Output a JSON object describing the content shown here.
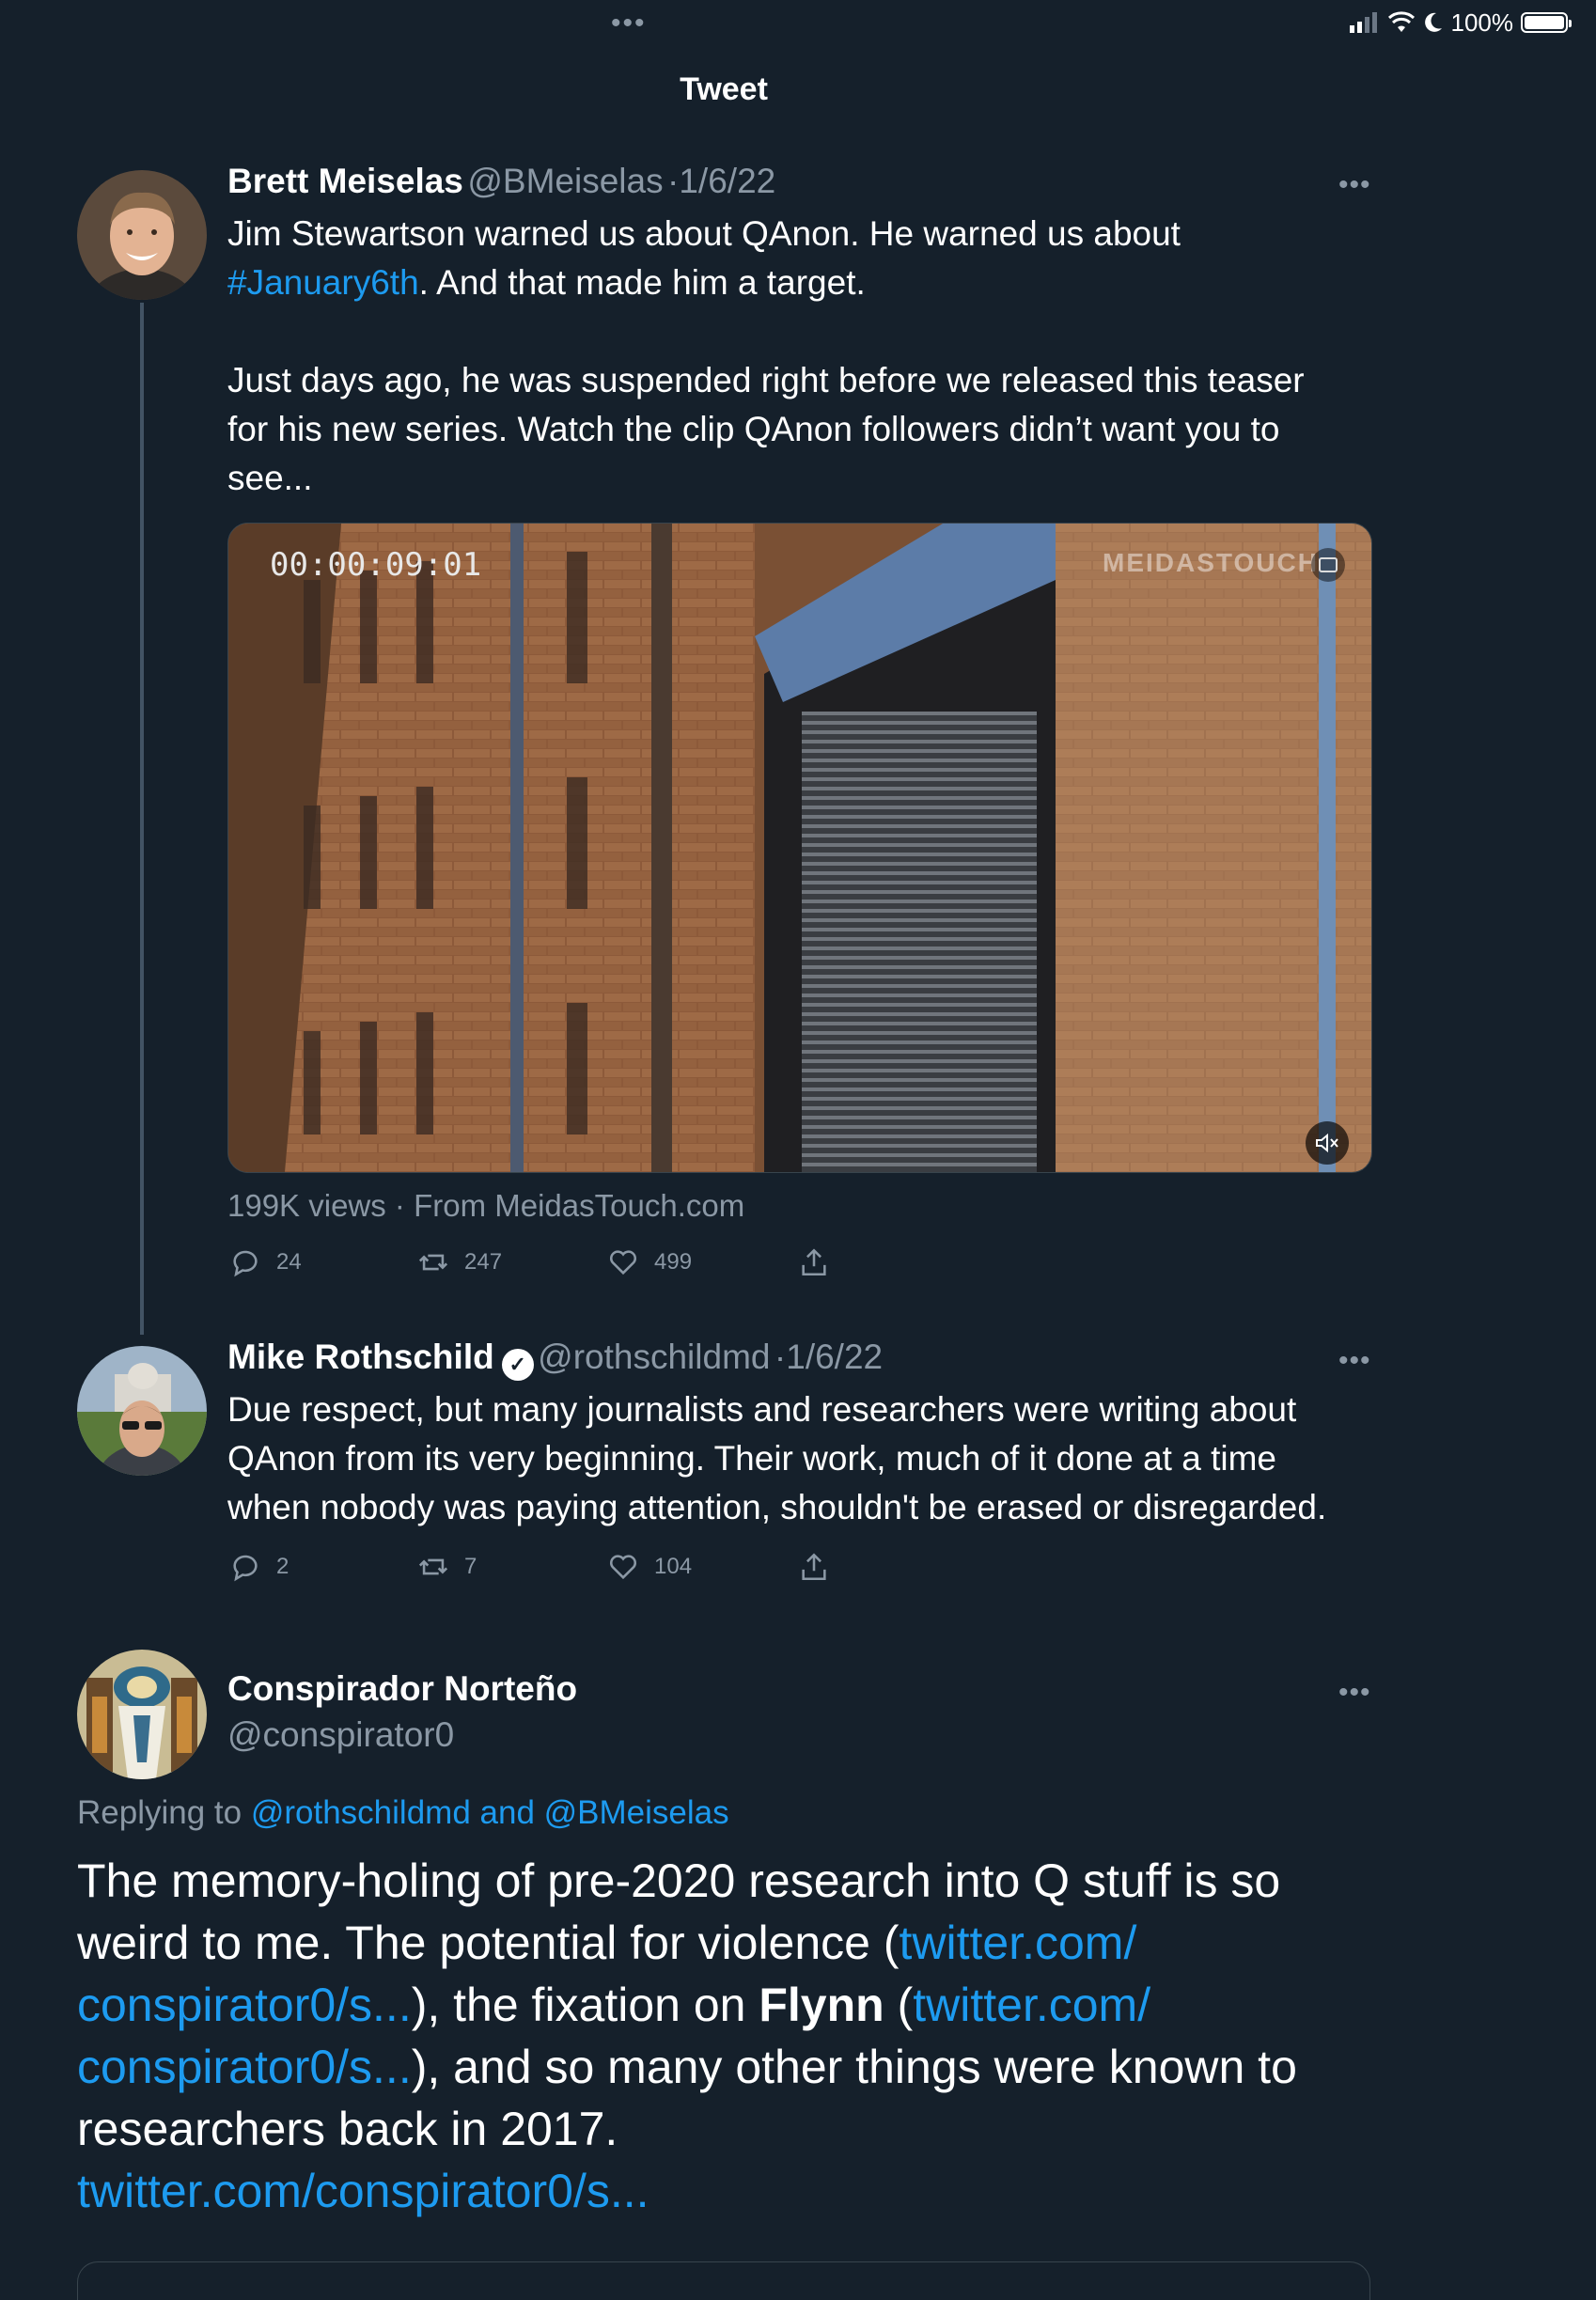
{
  "status_bar": {
    "battery": "100%"
  },
  "header": {
    "title": "Tweet"
  },
  "tweets": [
    {
      "name": "Brett Meiselas",
      "handle": "@BMeiselas",
      "date": "1/6/22",
      "text_a": "Jim Stewartson warned us about QAnon. He warned us about",
      "hashtag": "#January6th",
      "text_b": ". And that made him a target.",
      "text_c": "Just days ago, he was suspended right before we released this teaser",
      "text_d": "for his new series. Watch the clip QAnon followers didn’t want you to",
      "text_e": "see...",
      "video": {
        "timestamp": "00:00:09:01",
        "watermark": "MEIDASTOUCH"
      },
      "views": "199K views",
      "source": "From MeidasTouch.com",
      "replies": "24",
      "retweets": "247",
      "likes": "499"
    },
    {
      "name": "Mike Rothschild",
      "handle": "@rothschildmd",
      "date": "1/6/22",
      "line1": "Due respect, but many journalists and researchers were writing about",
      "line2": "QAnon from its very beginning. Their work, much of it done at a time",
      "line3": "when nobody was paying attention, shouldn't be erased or disregarded.",
      "replies": "2",
      "retweets": "7",
      "likes": "104"
    },
    {
      "name": "Conspirador Norteño",
      "handle": "@conspirator0",
      "replying_prefix": "Replying to",
      "replying_targets": "@rothschildmd and @BMeiselas",
      "l1": "The memory-holing of pre-2020 research into Q stuff is so",
      "l2a": "weird to me.  The potential for violence (",
      "l2link": "twitter.com/",
      "l3link": "conspirator0/s...",
      "l3b": "), the fixation on ",
      "l3bold": "Flynn",
      "l3c": " (",
      "l3link2": "twitter.com/",
      "l4link": "conspirator0/s...",
      "l4b": "), and so many other things were known to",
      "l5": "researchers back in 2017.",
      "l6link": "twitter.com/conspirator0/s..."
    }
  ]
}
